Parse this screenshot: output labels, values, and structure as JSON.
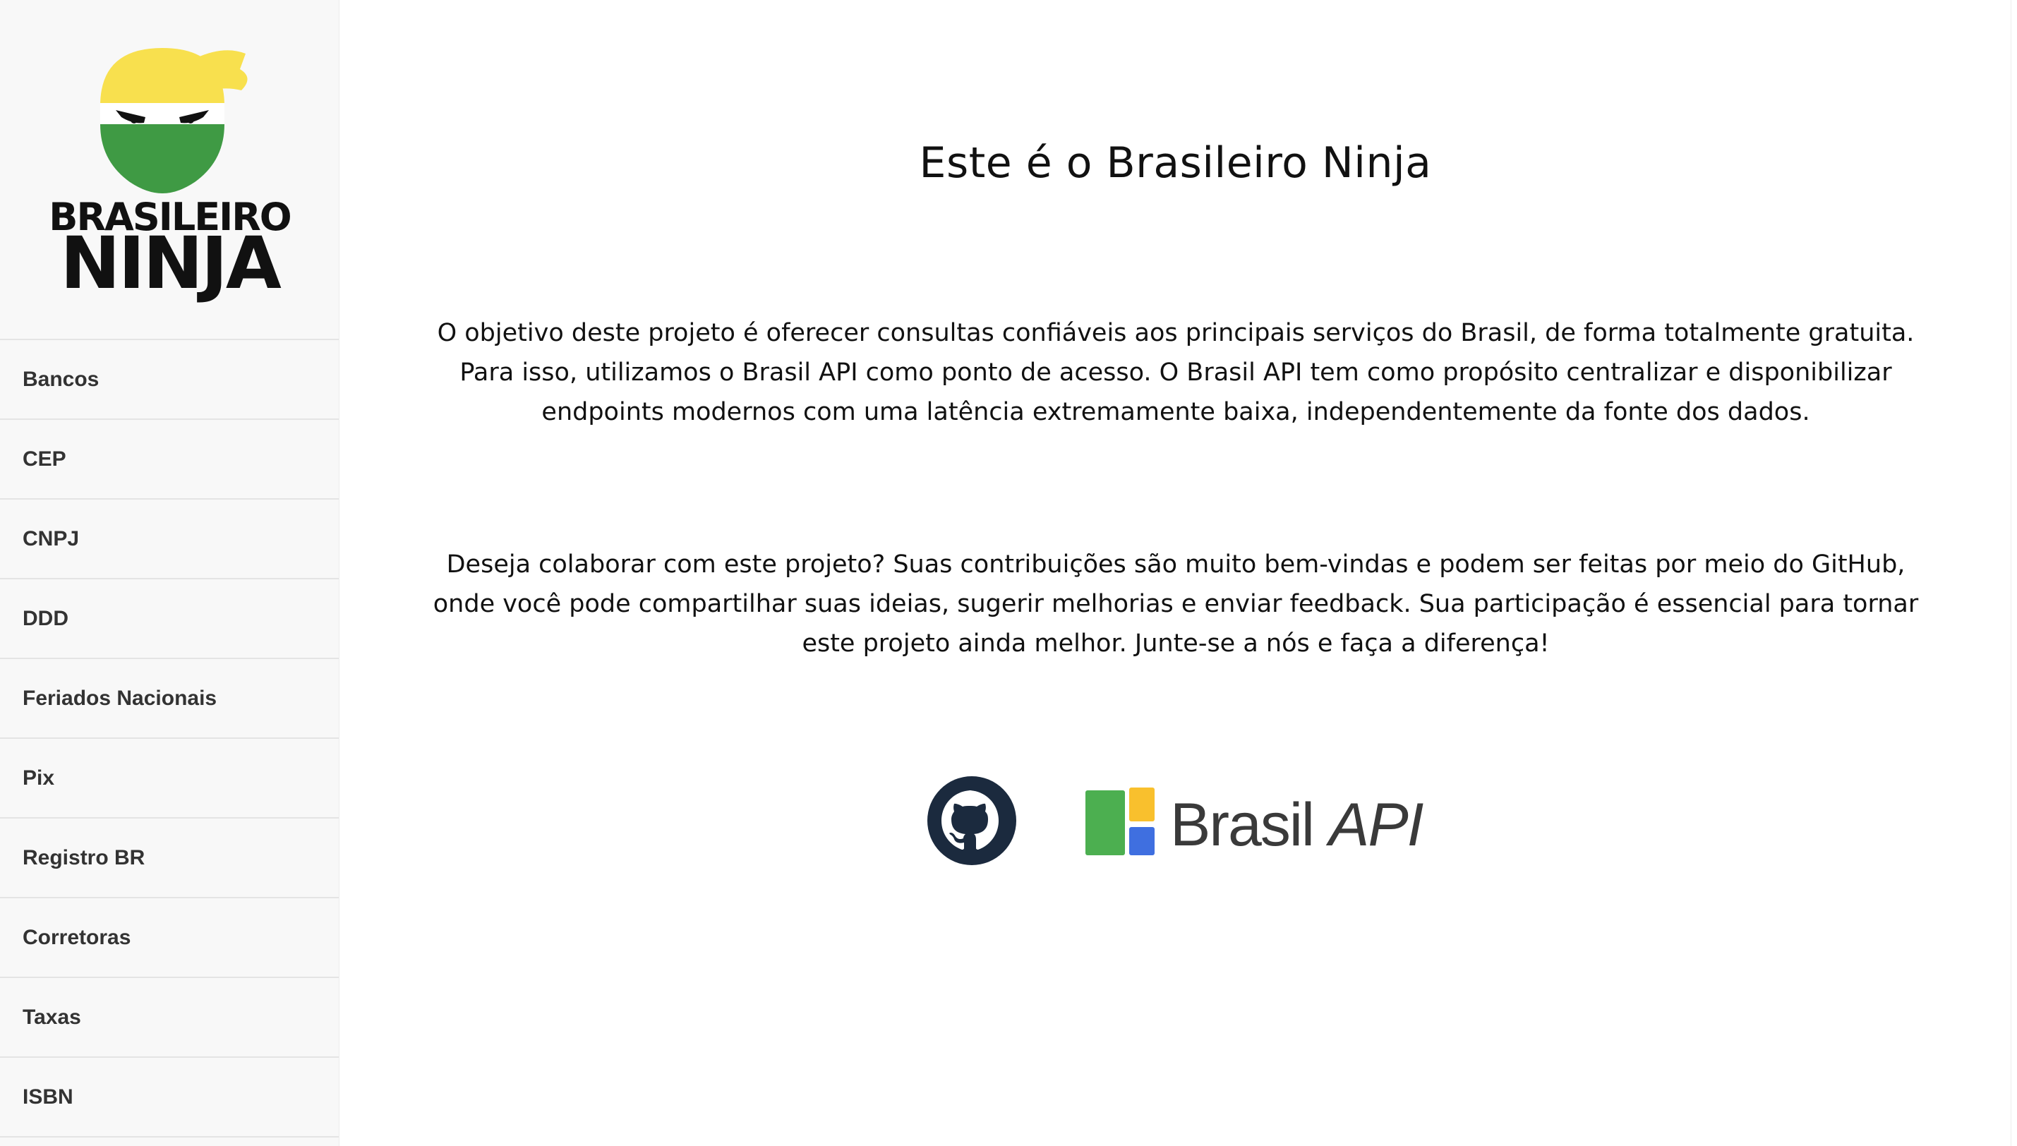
{
  "brand": {
    "line1": "BRASILEIRO",
    "line2": "NINJA"
  },
  "sidebar": {
    "items": [
      {
        "label": "Bancos"
      },
      {
        "label": "CEP"
      },
      {
        "label": "CNPJ"
      },
      {
        "label": "DDD"
      },
      {
        "label": "Feriados Nacionais"
      },
      {
        "label": "Pix"
      },
      {
        "label": "Registro BR"
      },
      {
        "label": "Corretoras"
      },
      {
        "label": "Taxas"
      },
      {
        "label": "ISBN"
      }
    ]
  },
  "main": {
    "title": "Este é o Brasileiro Ninja",
    "paragraph1": "O objetivo deste projeto é oferecer consultas confiáveis aos principais serviços do Brasil, de forma totalmente gratuita. Para isso, utilizamos o Brasil API como ponto de acesso. O Brasil API tem como propósito centralizar e disponibilizar endpoints modernos com uma latência extremamente baixa, independentemente da fonte dos dados.",
    "paragraph2": "Deseja colaborar com este projeto? Suas contribuições são muito bem-vindas e podem ser feitas por meio do GitHub, onde você pode compartilhar suas ideias, sugerir melhorias e enviar feedback. Sua participação é essencial para tornar este projeto ainda melhor. Junte-se a nós e faça a diferença!",
    "links": {
      "github_icon": "github-icon",
      "brasilapi_word1": "Brasil",
      "brasilapi_word2": "API"
    }
  },
  "colors": {
    "mask_yellow": "#f8e04e",
    "mask_green": "#3f9a44",
    "github_dark": "#1b2a3e",
    "brasilapi_green": "#4caf50",
    "brasilapi_yellow": "#f9c02d",
    "brasilapi_blue": "#3f6fe0"
  }
}
